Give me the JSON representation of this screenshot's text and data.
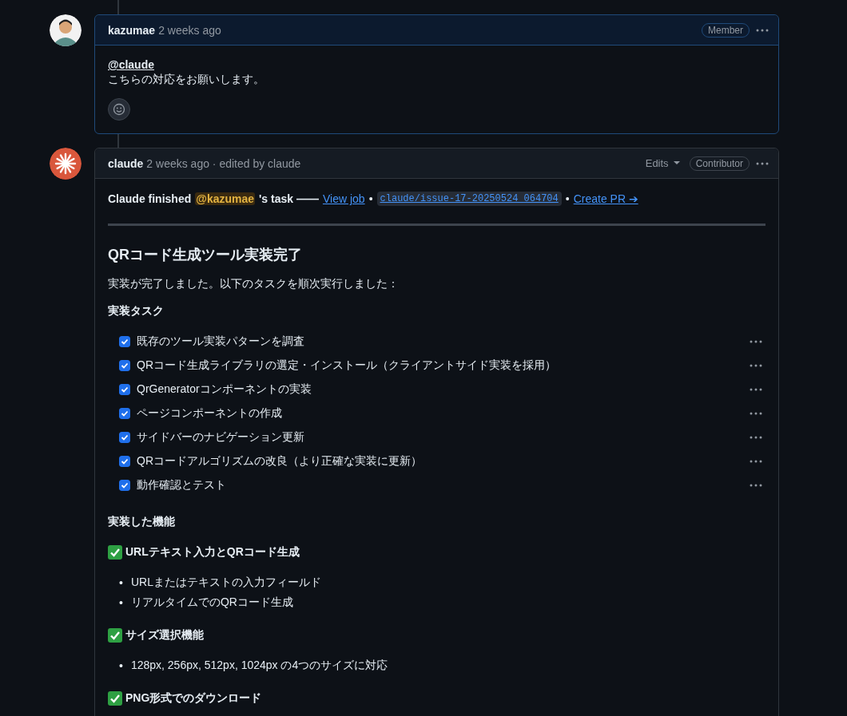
{
  "comments": [
    {
      "kind": "human",
      "author": "kazumae",
      "time": "2 weeks ago",
      "badge": "Member",
      "highlighted": true,
      "mention": "@claude",
      "body": "こちらの対応をお願いします。"
    },
    {
      "kind": "bot",
      "author": "claude",
      "time": "2 weeks ago · edited by claude",
      "edits": "Edits",
      "badge": "Contributor",
      "highlighted": false,
      "status_line": [
        {
          "kind": "strong",
          "text": "Claude finished"
        },
        {
          "kind": "mention",
          "text": "@kazumae"
        },
        {
          "kind": "strong",
          "text": "'s task ——"
        },
        {
          "kind": "link",
          "text": "View job"
        },
        {
          "kind": "sep",
          "text": "•"
        },
        {
          "kind": "code",
          "text": "claude/issue-17-20250524_064704"
        },
        {
          "kind": "sep",
          "text": "•"
        },
        {
          "kind": "link",
          "text": "Create PR ➔"
        }
      ],
      "heading": "QRコード生成ツール実装完了",
      "intro": "実装が完了しました。以下のタスクを順次実行しました：",
      "tasks_title": "実装タスク",
      "tasks": [
        {
          "text": "既存のツール実装パターンを調査",
          "checked": true
        },
        {
          "text": "QRコード生成ライブラリの選定・インストール（クライアントサイド実装を採用）",
          "checked": true
        },
        {
          "text": "QrGeneratorコンポーネントの実装",
          "checked": true
        },
        {
          "text": "ページコンポーネントの作成",
          "checked": true
        },
        {
          "text": "サイドバーのナビゲーション更新",
          "checked": true
        },
        {
          "text": "QRコードアルゴリズムの改良（より正確な実装に更新）",
          "checked": true
        },
        {
          "text": "動作確認とテスト",
          "checked": true
        }
      ],
      "features_title": "実装した機能",
      "features": [
        {
          "title": "URLテキスト入力とQRコード生成",
          "bullets": [
            {
              "marker": "•",
              "text": "URLまたはテキストの入力フィールド"
            },
            {
              "marker": "•",
              "text": "リアルタイムでのQRコード生成"
            }
          ]
        },
        {
          "title": "サイズ選択機能",
          "bullets": [
            {
              "marker": "•",
              "text": "128px, 256px, 512px, 1024px の4つのサイズに対応"
            }
          ]
        },
        {
          "title": "PNG形式でのダウンロード"
        }
      ]
    }
  ]
}
